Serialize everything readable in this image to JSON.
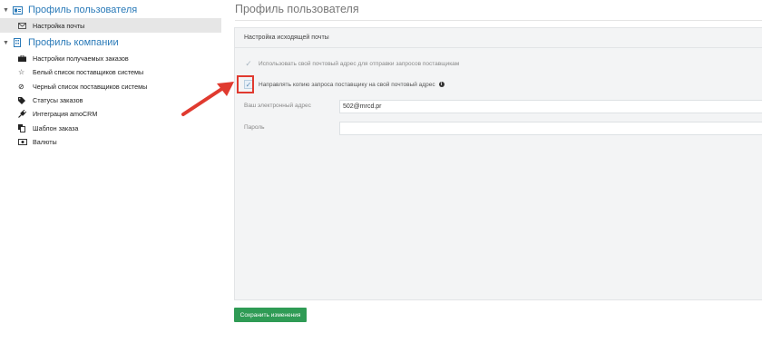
{
  "sidebar": {
    "user_profile": {
      "label": "Профиль пользователя",
      "items": [
        {
          "label": "Настройка почты",
          "icon": "envelope-icon"
        }
      ]
    },
    "company_profile": {
      "label": "Профиль компании",
      "items": [
        {
          "label": "Настройки получаемых заказов",
          "icon": "briefcase-icon"
        },
        {
          "label": "Белый список поставщиков системы",
          "icon": "star-icon"
        },
        {
          "label": "Черный список поставщиков системы",
          "icon": "ban-icon"
        },
        {
          "label": "Статусы заказов",
          "icon": "tags-icon"
        },
        {
          "label": "Интеграция amoCRM",
          "icon": "plug-icon"
        },
        {
          "label": "Шаблон заказа",
          "icon": "copy-icon"
        },
        {
          "label": "Валюты",
          "icon": "money-icon"
        }
      ]
    }
  },
  "main": {
    "title": "Профиль пользователя",
    "panel": {
      "header": "Настройка исходящей почты",
      "use_own_address_label": "Использовать свой почтовый адрес для отправки запросов поставщикам",
      "send_copy_label": "Направлять копию запроса поставщику на свой почтовый адрес",
      "email_label": "Ваш электронный адрес",
      "email_value": "502@mrcd.pr",
      "password_label": "Пароль",
      "password_value": ""
    },
    "save_button": "Сохранить изменения"
  },
  "colors": {
    "accent": "#2a7ab8",
    "save_button": "#2f9b55",
    "highlight": "#e03a2f"
  }
}
